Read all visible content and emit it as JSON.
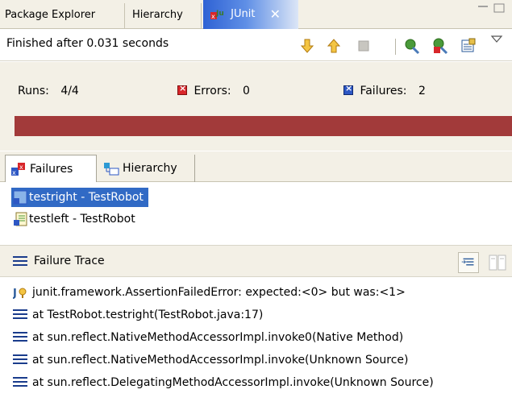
{
  "tabs": [
    {
      "label": "Package Explorer"
    },
    {
      "label": "Hierarchy"
    },
    {
      "label": "JUnit",
      "active": true
    }
  ],
  "toolbar": {
    "status": "Finished after 0.031 seconds"
  },
  "counters": {
    "runs_label": "Runs:",
    "runs_value": "4/4",
    "errors_label": "Errors:",
    "errors_value": "0",
    "failures_label": "Failures:",
    "failures_value": "2"
  },
  "progress": {
    "fraction": 1.0,
    "color": "#a23a3a"
  },
  "subtabs": [
    {
      "label": "Failures"
    },
    {
      "label": "Hierarchy"
    }
  ],
  "failures": [
    {
      "label": "testright - TestRobot",
      "selected": true
    },
    {
      "label": "testleft - TestRobot",
      "selected": false
    }
  ],
  "trace": {
    "header": "Failure Trace",
    "lines": [
      "junit.framework.AssertionFailedError: expected:<0> but was:<1>",
      "at TestRobot.testright(TestRobot.java:17)",
      "at sun.reflect.NativeMethodAccessorImpl.invoke0(Native Method)",
      "at sun.reflect.NativeMethodAccessorImpl.invoke(Unknown Source)",
      "at sun.reflect.DelegatingMethodAccessorImpl.invoke(Unknown Source)"
    ]
  },
  "colors": {
    "error": "#d8262a",
    "failure_blue": "#2d57c4",
    "selection": "#316ac5"
  }
}
